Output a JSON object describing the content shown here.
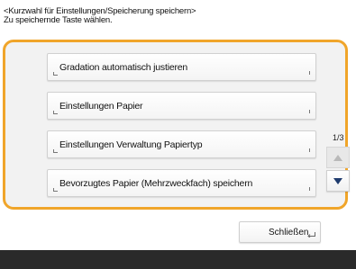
{
  "header": {
    "line1": "<Kurzwahl für Einstellungen/Speicherung speichern>",
    "line2": "Zu speichernde Taste wählen."
  },
  "list": {
    "items": [
      {
        "label": "Gradation automatisch justieren"
      },
      {
        "label": "Einstellungen Papier"
      },
      {
        "label": "Einstellungen Verwaltung Papiertyp"
      },
      {
        "label": "Bevorzugtes Papier (Mehrzweckfach) speichern"
      }
    ]
  },
  "pagination": {
    "indicator": "1/3",
    "up_icon": "triangle-up-icon",
    "down_icon": "triangle-down-icon"
  },
  "footer": {
    "close_label": "Schließen",
    "close_icon": "return-arrow-icon"
  },
  "colors": {
    "panel_border": "#f0a52a",
    "bottom_bar": "#2a2a2a"
  }
}
